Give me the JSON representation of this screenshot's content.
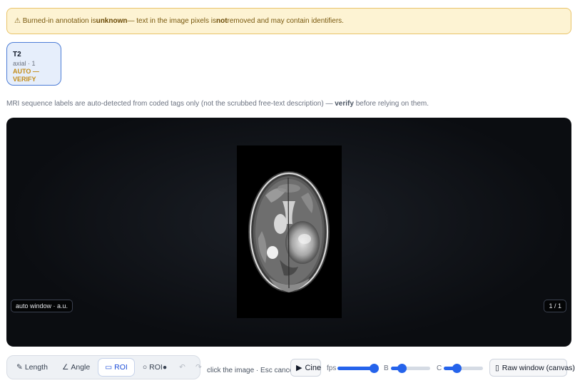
{
  "banner": {
    "prefix": "⚠ Burned-in annotation is ",
    "strong1": "unknown",
    "middle": " — text in the image pixels is ",
    "strong2": "not",
    "suffix": " removed and may contain identifiers."
  },
  "series": {
    "title": "T2",
    "subtitle": "axial · 1",
    "status": "AUTO — VERIFY"
  },
  "note": {
    "prefix": "MRI sequence labels are auto-detected from coded tags only (not the scrubbed free-text description) — ",
    "strong": "verify",
    "suffix": " before relying on them."
  },
  "viewer": {
    "window_badge": "auto window · a.u.",
    "frame_badge": "1 / 1"
  },
  "toolbar": {
    "tools": [
      {
        "icon": "✎",
        "label": "Length"
      },
      {
        "icon": "∠",
        "label": "Angle"
      },
      {
        "icon": "▭",
        "label": "ROI"
      },
      {
        "icon": "○",
        "label": "ROI●"
      }
    ],
    "undo": "↶",
    "redo": "↷",
    "hint": "click the image · Esc cancels"
  },
  "controls": {
    "cine_icon": "▶",
    "cine_label": "Cine",
    "fps_label": "fps",
    "fps_level": 0.9,
    "b_label": "B",
    "b_level": 0.28,
    "c_label": "C",
    "c_level": 0.33,
    "raw_icon": "▯",
    "raw_label": "Raw window (canvas)"
  },
  "colors": {
    "accent": "#2563eb",
    "warning_bg": "#fdf3d3",
    "warning_text": "#7a5a10"
  }
}
